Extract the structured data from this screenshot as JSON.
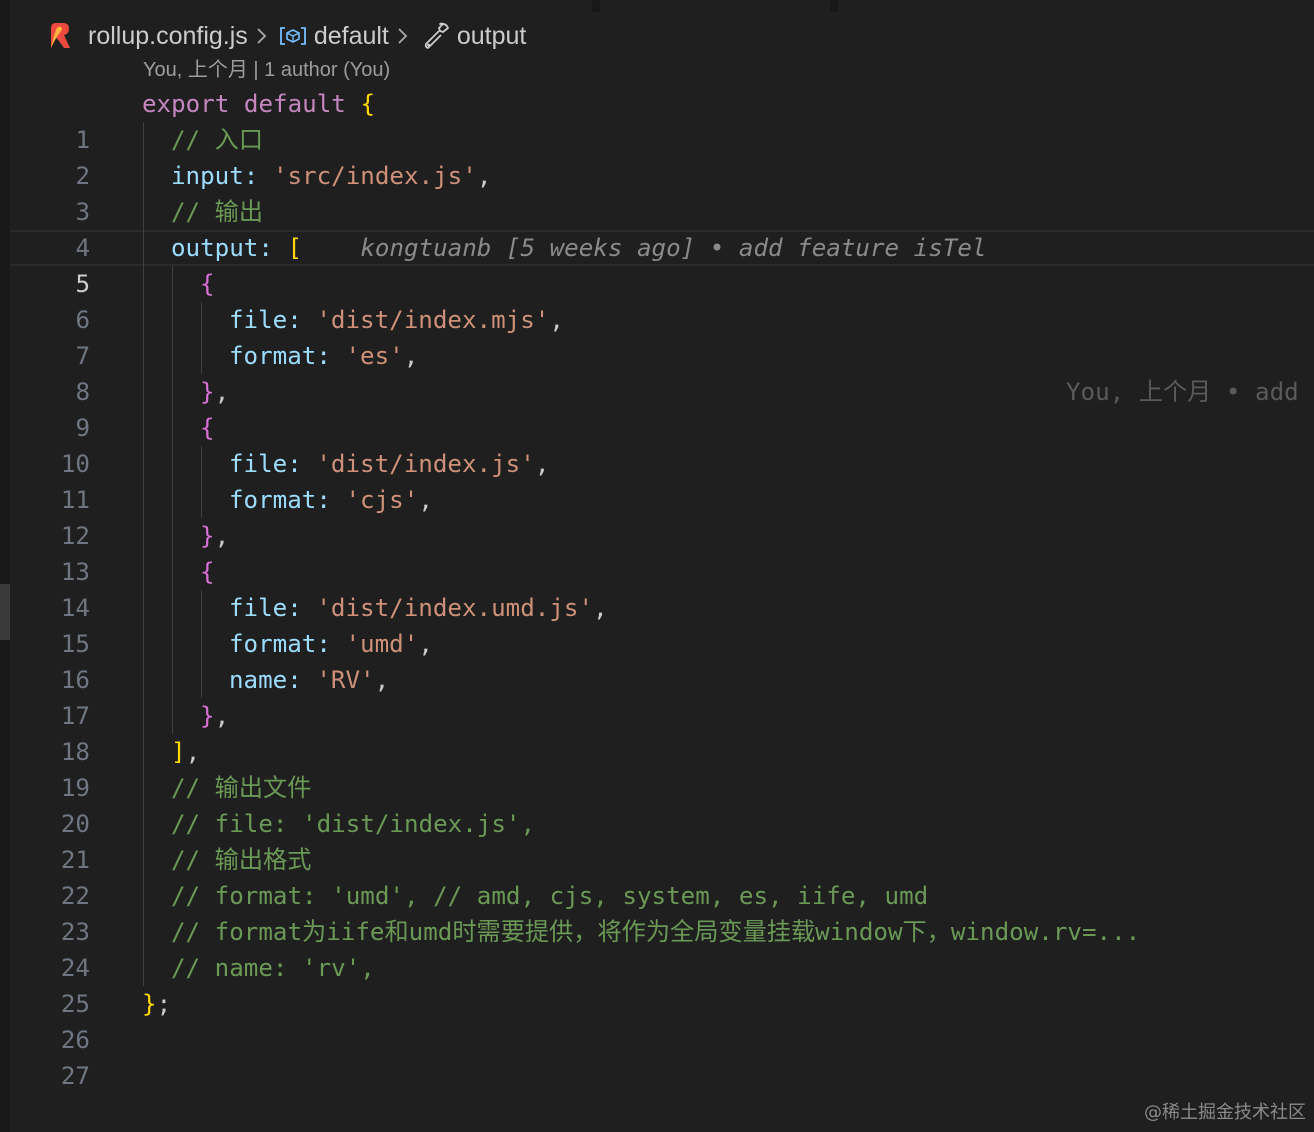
{
  "breadcrumb": {
    "file_icon": "rollup-logo-icon",
    "file": "rollup.config.js",
    "separator_icon": "chevron-right-icon",
    "symbol_icon": "symbol-variable-icon",
    "symbol": "default",
    "property_icon": "wrench-icon",
    "property": "output"
  },
  "codelens": {
    "text": "You, 上个月 | 1 author (You)"
  },
  "editor": {
    "current_line": 5,
    "lines": [
      {
        "number": "1"
      },
      {
        "number": "2"
      },
      {
        "number": "3"
      },
      {
        "number": "4"
      },
      {
        "number": "5"
      },
      {
        "number": "6"
      },
      {
        "number": "7"
      },
      {
        "number": "8"
      },
      {
        "number": "9"
      },
      {
        "number": "10"
      },
      {
        "number": "11"
      },
      {
        "number": "12"
      },
      {
        "number": "13"
      },
      {
        "number": "14"
      },
      {
        "number": "15"
      },
      {
        "number": "16"
      },
      {
        "number": "17"
      },
      {
        "number": "18"
      },
      {
        "number": "19"
      },
      {
        "number": "20"
      },
      {
        "number": "21"
      },
      {
        "number": "22"
      },
      {
        "number": "23"
      },
      {
        "number": "24"
      },
      {
        "number": "25"
      },
      {
        "number": "26"
      },
      {
        "number": "27"
      }
    ],
    "tokens": {
      "l1_kw": "export default",
      "l1_brace": "{",
      "l2_com": "// 入口",
      "l3_key": "input:",
      "l3_str": "'src/index.js'",
      "l3_punct": ",",
      "l4_com": "// 输出",
      "l5_key": "output:",
      "l5_bracket": "[",
      "l5_blame": "kongtuanb [5 weeks ago] • add feature isTel",
      "l5_blame_right": "You, 上个月 • add",
      "l6_brace": "{",
      "l7_key": "file:",
      "l7_str": "'dist/index.mjs'",
      "l7_punct": ",",
      "l8_key": "format:",
      "l8_str": "'es'",
      "l8_punct": ",",
      "l9_brace": "}",
      "l9_punct": ",",
      "l10_brace": "{",
      "l11_key": "file:",
      "l11_str": "'dist/index.js'",
      "l11_punct": ",",
      "l12_key": "format:",
      "l12_str": "'cjs'",
      "l12_punct": ",",
      "l13_brace": "}",
      "l13_punct": ",",
      "l14_brace": "{",
      "l15_key": "file:",
      "l15_str": "'dist/index.umd.js'",
      "l15_punct": ",",
      "l16_key": "format:",
      "l16_str": "'umd'",
      "l16_punct": ",",
      "l17_key": "name:",
      "l17_str": "'RV'",
      "l17_punct": ",",
      "l18_brace": "}",
      "l18_punct": ",",
      "l19_bracket": "]",
      "l19_punct": ",",
      "l20_com": "// 输出文件",
      "l21_com": "// file: 'dist/index.js',",
      "l22_com": "// 输出格式",
      "l23_com": "// format: 'umd', // amd, cjs, system, es, iife, umd",
      "l24_com": "// format为iife和umd时需要提供，将作为全局变量挂载window下，window.rv=...",
      "l25_com": "// name: 'rv',",
      "l26_brace": "}",
      "l26_punct": ";"
    }
  },
  "watermark": {
    "text": "@稀土掘金技术社区"
  },
  "colors": {
    "background": "#1f1f1f",
    "keyword": "#c586c0",
    "property": "#9cdcfe",
    "string": "#ce9178",
    "comment": "#6a9955",
    "bracket_level1": "#ffd700",
    "bracket_level2": "#da70d6",
    "line_number": "#6e7681"
  }
}
